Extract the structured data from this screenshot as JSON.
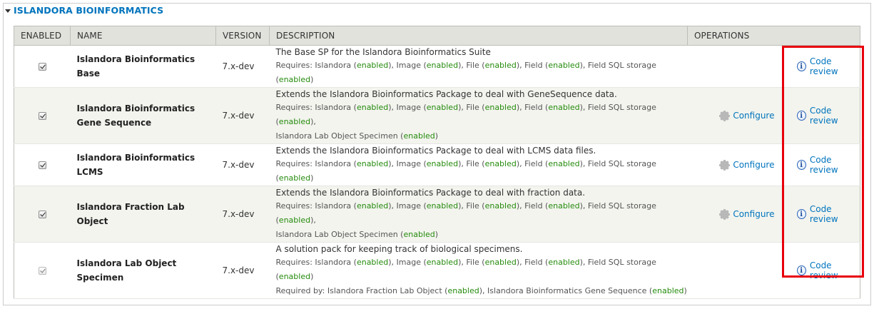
{
  "section": {
    "title": "ISLANDORA BIOINFORMATICS"
  },
  "table": {
    "headers": {
      "enabled": "ENABLED",
      "name": "NAME",
      "version": "VERSION",
      "description": "DESCRIPTION",
      "operations": "OPERATIONS"
    },
    "rows": [
      {
        "name": "Islandora Bioinformatics Base",
        "version": "7.x-dev",
        "description": "The Base SP for the Islandora Bioinformatics Suite",
        "enabled": true,
        "configure": "",
        "code_review": "Code review"
      },
      {
        "name": "Islandora Bioinformatics Gene Sequence",
        "version": "7.x-dev",
        "description": "Extends the Islandora Bioinformatics Package to deal with GeneSequence data.",
        "enabled": true,
        "configure": "Configure",
        "code_review": "Code review"
      },
      {
        "name": "Islandora Bioinformatics LCMS",
        "version": "7.x-dev",
        "description": "Extends the Islandora Bioinformatics Package to deal with LCMS data files.",
        "enabled": true,
        "configure": "Configure",
        "code_review": "Code review"
      },
      {
        "name": "Islandora Fraction Lab Object",
        "version": "7.x-dev",
        "description": "Extends the Islandora Bioinformatics Package to deal with fraction data.",
        "enabled": true,
        "configure": "Configure",
        "code_review": "Code review"
      },
      {
        "name": "Islandora Lab Object Specimen",
        "version": "7.x-dev",
        "description": "A solution pack for keeping track of biological specimens.",
        "enabled": true,
        "configure": "",
        "code_review": "Code review"
      }
    ]
  },
  "labels": {
    "requires": "Requires: ",
    "required_by": "Required by: ",
    "enabled": "enabled"
  },
  "deps": {
    "islandora": "Islandora",
    "image": "Image",
    "file": "File",
    "field": "Field",
    "field_sql": "Field SQL storage",
    "specimen": "Islandora Lab Object Specimen",
    "fraction": "Islandora Fraction Lab Object",
    "gene": "Islandora Bioinformatics Gene Sequence"
  },
  "colors": {
    "link": "#0074bd",
    "enabled": "#258b0d",
    "highlight": "#e8000b"
  },
  "icons": {
    "legend_toggle": "triangle-down-icon",
    "configure": "gear-icon",
    "code_review": "info-icon"
  }
}
